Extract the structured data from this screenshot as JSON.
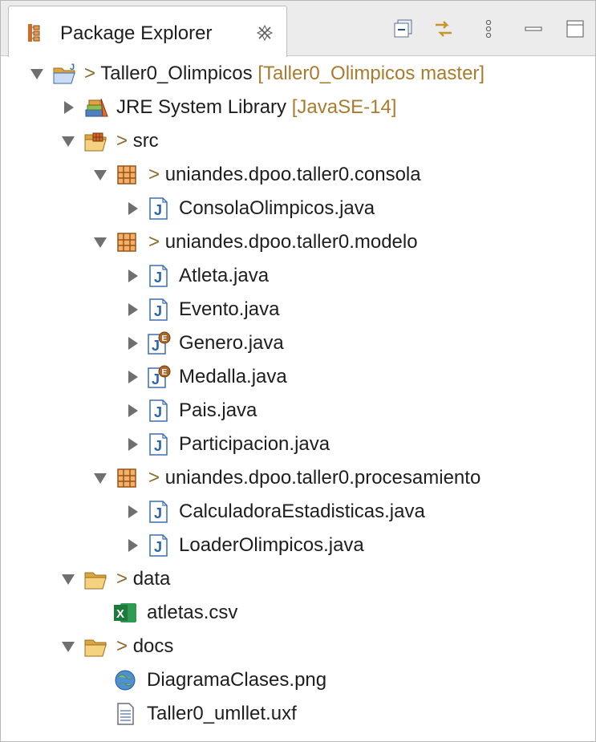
{
  "view": {
    "title": "Package Explorer",
    "toolbar_icons": [
      "collapse-all-icon",
      "link-with-editor-icon",
      "view-menu-icon",
      "minimize-icon",
      "maximize-icon"
    ]
  },
  "tree": {
    "project": {
      "prefix": ">",
      "label": "Taller0_Olimpicos",
      "decoration": "[Taller0_Olimpicos master]"
    },
    "jre": {
      "label": "JRE System Library",
      "decoration": "[JavaSE-14]"
    },
    "src": {
      "prefix": ">",
      "label": "src"
    },
    "pkg_consola": {
      "prefix": ">",
      "label": "uniandes.dpoo.taller0.consola"
    },
    "consola_files": [
      "ConsolaOlimpicos.java"
    ],
    "pkg_modelo": {
      "prefix": ">",
      "label": "uniandes.dpoo.taller0.modelo"
    },
    "modelo_files": [
      "Atleta.java",
      "Evento.java",
      "Genero.java",
      "Medalla.java",
      "Pais.java",
      "Participacion.java"
    ],
    "pkg_procesamiento": {
      "prefix": ">",
      "label": "uniandes.dpoo.taller0.procesamiento"
    },
    "procesamiento_files": [
      "CalculadoraEstadisticas.java",
      "LoaderOlimpicos.java"
    ],
    "data_folder": {
      "prefix": ">",
      "label": "data"
    },
    "data_files": [
      "atletas.csv"
    ],
    "docs_folder": {
      "prefix": ">",
      "label": "docs"
    },
    "docs_files": [
      "DiagramaClases.png",
      "Taller0_umllet.uxf"
    ]
  }
}
